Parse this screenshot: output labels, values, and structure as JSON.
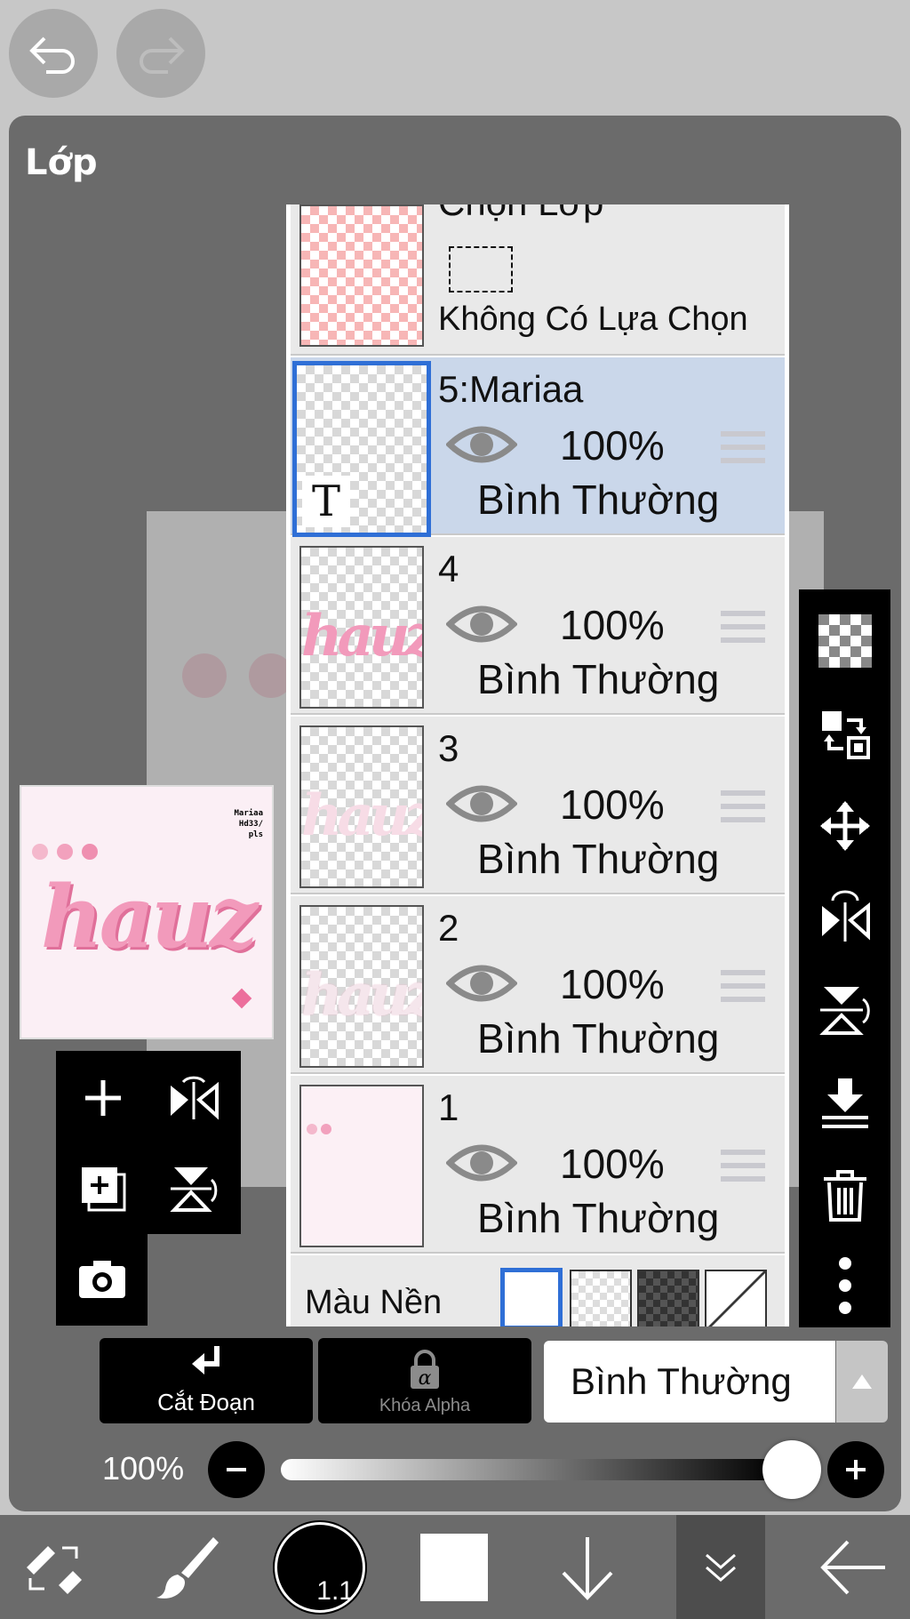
{
  "toolbar_top": {
    "undo_icon": "undo-icon",
    "redo_icon": "redo-icon"
  },
  "panel": {
    "title": "Lớp"
  },
  "thumbnail": {
    "watermark_lines": [
      "Mariaa",
      "Hd33/",
      "pls"
    ],
    "art_text": "hauz"
  },
  "selection_row": {
    "title": "Chọn Lớp",
    "status": "Không Có Lựa Chọn"
  },
  "layers": [
    {
      "name": "5:Mariaa",
      "opacity": "100%",
      "blend": "Bình Thường",
      "selected": true,
      "type_marker": "T"
    },
    {
      "name": "4",
      "opacity": "100%",
      "blend": "Bình Thường",
      "selected": false
    },
    {
      "name": "3",
      "opacity": "100%",
      "blend": "Bình Thường",
      "selected": false
    },
    {
      "name": "2",
      "opacity": "100%",
      "blend": "Bình Thường",
      "selected": false
    },
    {
      "name": "1",
      "opacity": "100%",
      "blend": "Bình Thường",
      "selected": false
    }
  ],
  "background_row": {
    "label": "Màu Nền"
  },
  "controls": {
    "clip_label": "Cắt Đoạn",
    "alpha_lock_label": "Khóa Alpha",
    "blend_mode": "Bình Thường",
    "opacity_label": "100%",
    "opacity_value": 1.0
  },
  "bottom_toolbar": {
    "brush_size": "1.1"
  },
  "colors": {
    "selected_row": "#cad7ea",
    "selected_border": "#2f6fd6",
    "panel": "#6b6b6b"
  }
}
